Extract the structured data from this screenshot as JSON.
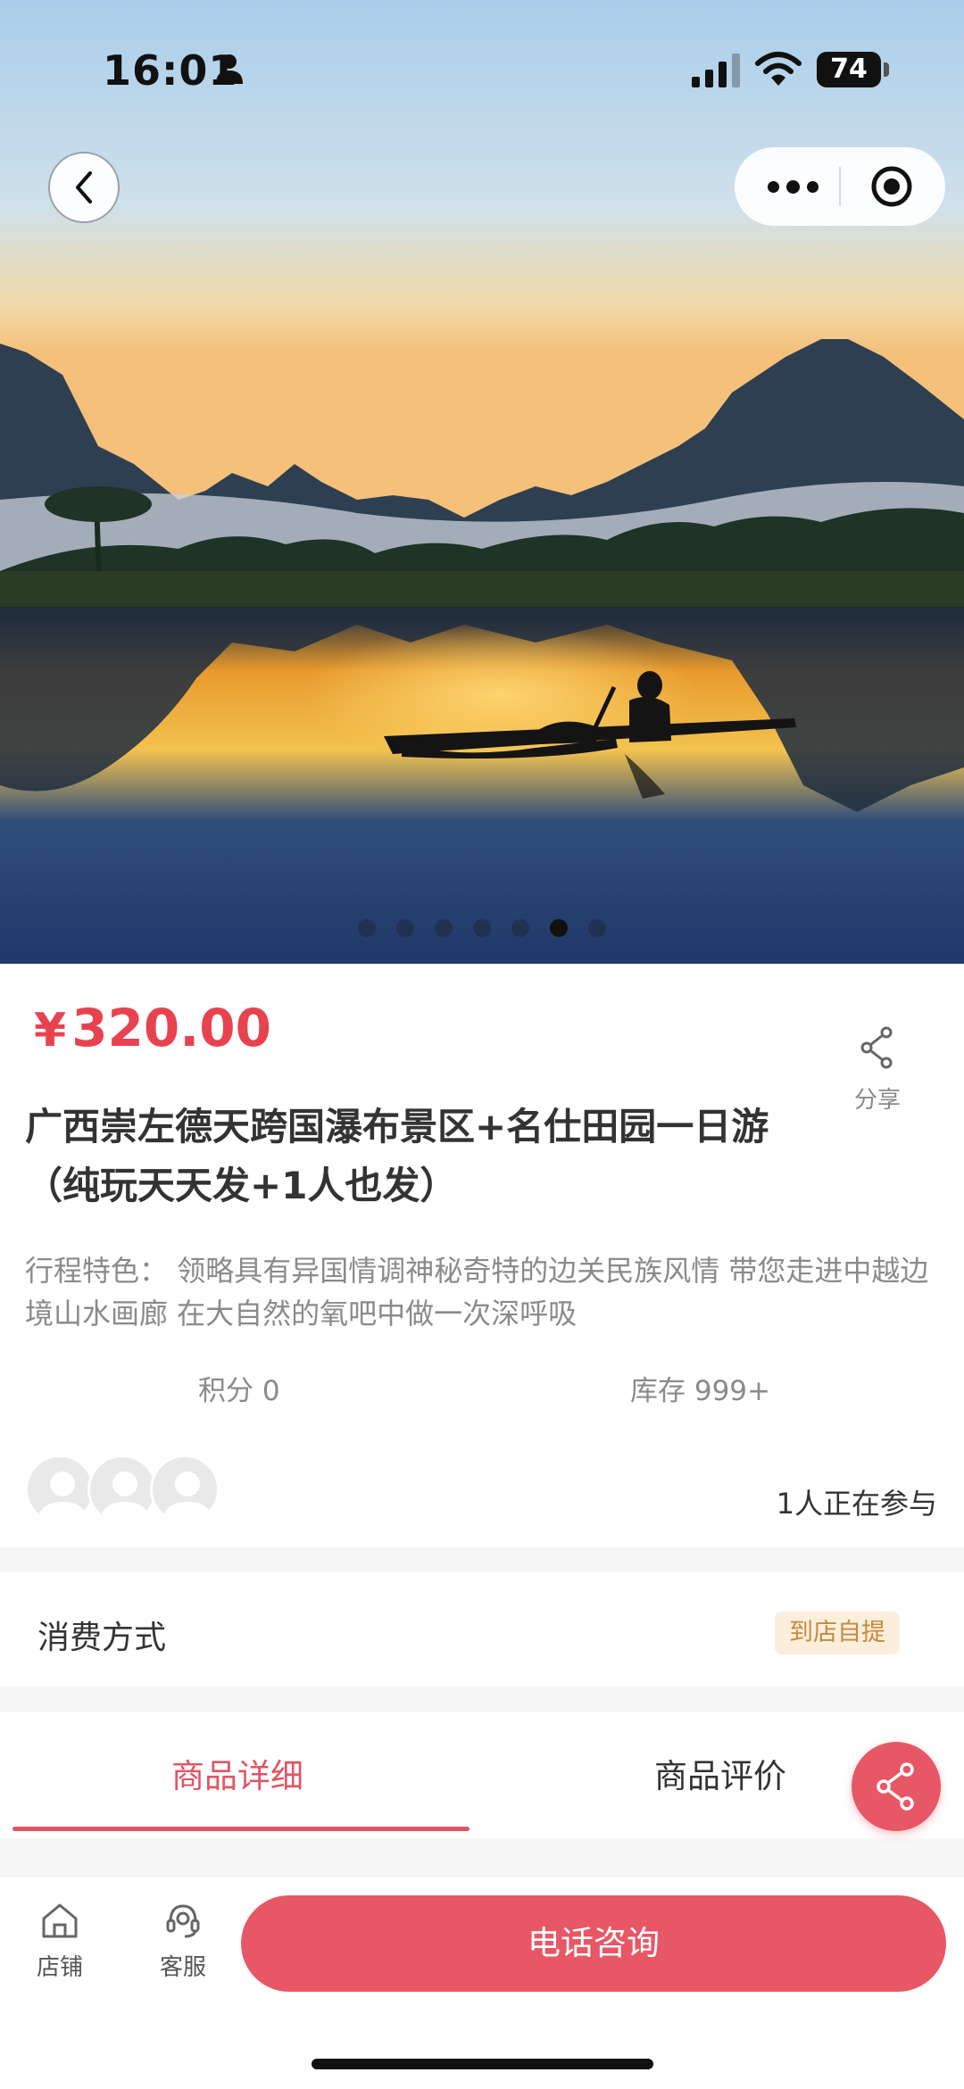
{
  "status_bar": {
    "time": "16:01",
    "battery": "74"
  },
  "carousel": {
    "total": 7,
    "active_index": 5
  },
  "product": {
    "currency": "¥",
    "price": "320.00",
    "title_line1": "广西崇左德天跨国瀑布景区+名仕田园一日游",
    "title_line2": "（纯玩天天发+1人也发）",
    "desc_label": "行程特色：",
    "desc_text": " 领略具有异国情调神秘奇特的边关民族风情 带您走进中越边境山水画廊 在大自然的氧吧中做一次深呼吸",
    "points": "积分 0",
    "stock": "库存 999+"
  },
  "share": {
    "label": "分享"
  },
  "participants": {
    "text": "1人正在参与"
  },
  "consumption": {
    "label": "消费方式",
    "badge": "到店自提"
  },
  "tabs": [
    {
      "label": "商品详细",
      "active": true
    },
    {
      "label": "商品评价",
      "active": false
    }
  ],
  "bottom_nav": {
    "store_label": "店铺",
    "service_label": "客服",
    "call_label": "电话咨询"
  },
  "colors": {
    "accent": "#e8424f",
    "button": "#e85766",
    "badge_bg": "#fbeedd",
    "badge_text": "#c58a3c"
  }
}
